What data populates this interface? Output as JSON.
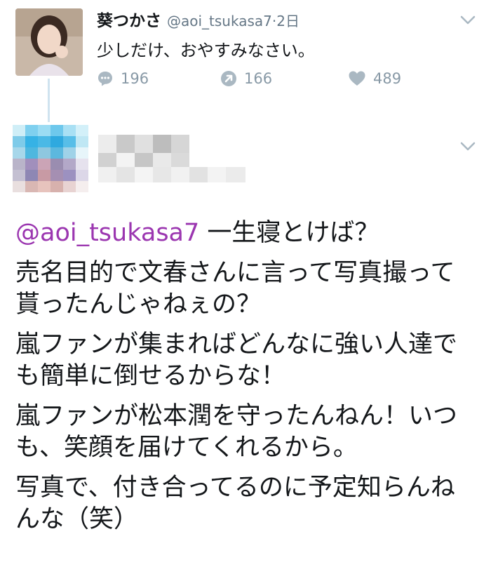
{
  "tweet": {
    "display_name": "葵つかさ",
    "handle": "@aoi_tsukasa7",
    "separator": "·",
    "time": "2日",
    "text": "少しだけ、おやすみなさい。",
    "replies": "196",
    "retweets": "166",
    "likes": "489"
  },
  "reply": {
    "mention": "@aoi_tsukasa7",
    "para1_rest": " 一生寝とけば？",
    "para2": "売名目的で文春さんに言って写真撮って貰ったんじゃねぇの？",
    "para3": "嵐ファンが集まればどんなに強い人達でも簡単に倒せるからな！",
    "para4": "嵐ファンが松本潤を守ったんねん！いつも、笑顔を届けてくれるから。",
    "para5": "写真で、付き合ってるのに予定知らんねんな（笑）"
  },
  "colors": {
    "mention": "#9b36b0",
    "icon_gray": "#aab8c2",
    "thread_line": "#cfe3ef"
  },
  "icons": [
    "chevron-down-icon",
    "reply-icon",
    "retweet-icon",
    "heart-icon"
  ]
}
